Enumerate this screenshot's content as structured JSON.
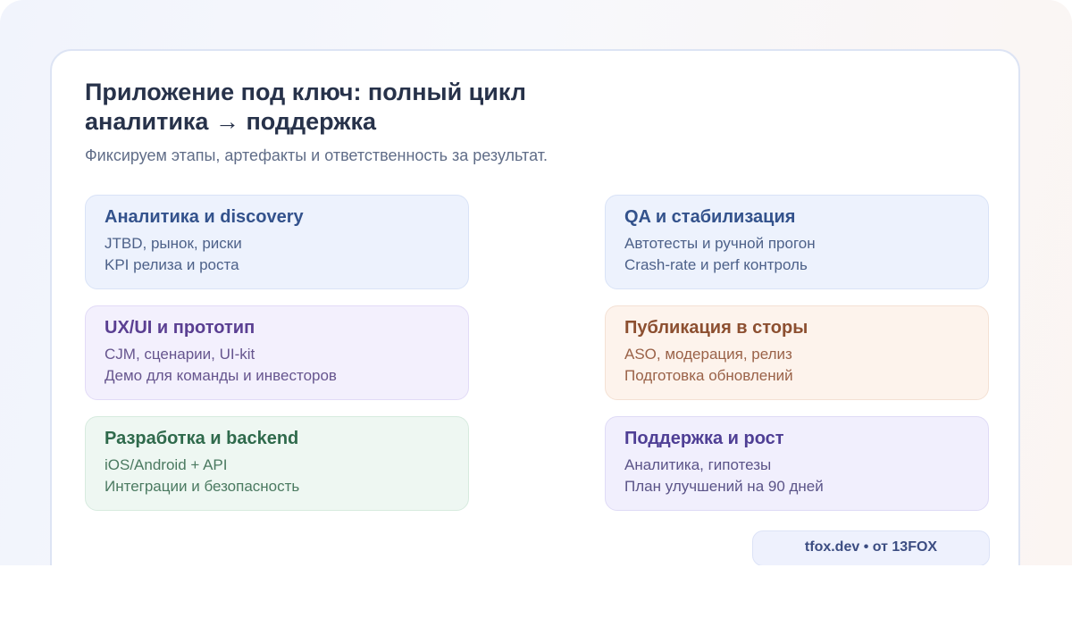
{
  "header": {
    "title": "Приложение под ключ: полный цикл аналитика → поддержка",
    "subtitle": "Фиксируем этапы, артефакты и ответственность за результат."
  },
  "stages": [
    {
      "title": "Аналитика и discovery",
      "lines": [
        "JTBD, рынок, риски",
        "KPI релиза и роста"
      ],
      "color": "#edf2fd"
    },
    {
      "title": "UX/UI и прототип",
      "lines": [
        "CJM, сценарии, UI-kit",
        "Демо для команды и инвесторов"
      ],
      "color": "#f3f0fd"
    },
    {
      "title": "Разработка и backend",
      "lines": [
        "iOS/Android + API",
        "Интеграции и безопасность"
      ],
      "color": "#eef7f2"
    },
    {
      "title": "QA и стабилизация",
      "lines": [
        "Автотесты и ручной прогон",
        "Crash-rate и perf контроль"
      ],
      "color": "#edf2fd"
    },
    {
      "title": "Публикация в сторы",
      "lines": [
        "ASO, модерация, релиз",
        "Подготовка обновлений"
      ],
      "color": "#fdf3ec"
    },
    {
      "title": "Поддержка и рост",
      "lines": [
        "Аналитика, гипотезы",
        "План улучшений на 90 дней"
      ],
      "color": "#f1effd"
    }
  ],
  "footer": {
    "badge": "tfox.dev • от 13FOX"
  }
}
